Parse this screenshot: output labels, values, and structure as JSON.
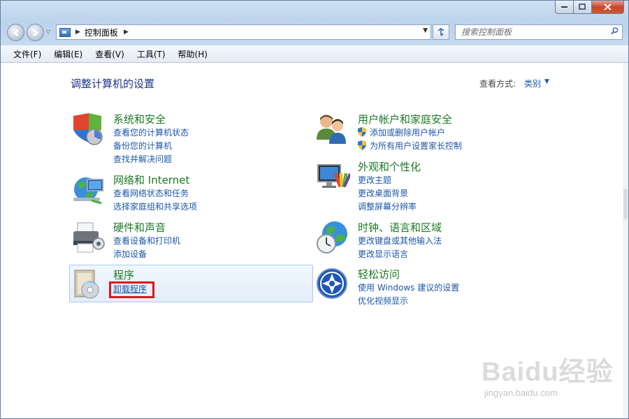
{
  "window": {
    "title": "控制面板"
  },
  "navigation": {
    "breadcrumb": "控制面板",
    "search_placeholder": "搜索控制面板"
  },
  "menu": {
    "items": [
      "文件(F)",
      "编辑(E)",
      "查看(V)",
      "工具(T)",
      "帮助(H)"
    ]
  },
  "main": {
    "title": "调整计算机的设置",
    "view_by_label": "查看方式:",
    "view_by_value": "类别",
    "categories": [
      {
        "title": "系统和安全",
        "icon": "shield-icon",
        "links": [
          "查看您的计算机状态",
          "备份您的计算机",
          "查找并解决问题"
        ]
      },
      {
        "title": "网络和 Internet",
        "icon": "network-icon",
        "links": [
          "查看网络状态和任务",
          "选择家庭组和共享选项"
        ]
      },
      {
        "title": "硬件和声音",
        "icon": "printer-icon",
        "links": [
          "查看设备和打印机",
          "添加设备"
        ]
      },
      {
        "title": "程序",
        "icon": "programs-icon",
        "links": [
          "卸载程序"
        ]
      },
      {
        "title": "用户帐户和家庭安全",
        "icon": "users-icon",
        "links": [
          "添加或删除用户帐户",
          "为所有用户设置家长控制"
        ]
      },
      {
        "title": "外观和个性化",
        "icon": "monitor-icon",
        "links": [
          "更改主题",
          "更改桌面背景",
          "调整屏幕分辨率"
        ]
      },
      {
        "title": "时钟、语言和区域",
        "icon": "globe-clock-icon",
        "links": [
          "更改键盘或其他输入法",
          "更改显示语言"
        ]
      },
      {
        "title": "轻松访问",
        "icon": "accessibility-icon",
        "links": [
          "使用 Windows 建议的设置",
          "优化视频显示"
        ]
      }
    ]
  },
  "watermark": {
    "text": "Baidu经验",
    "url": "jingyan.baidu.com"
  },
  "colors": {
    "link": "#1c57a6",
    "category_title": "#1b7a24",
    "page_title": "#1e3287",
    "highlight_box": "#e0141c"
  }
}
